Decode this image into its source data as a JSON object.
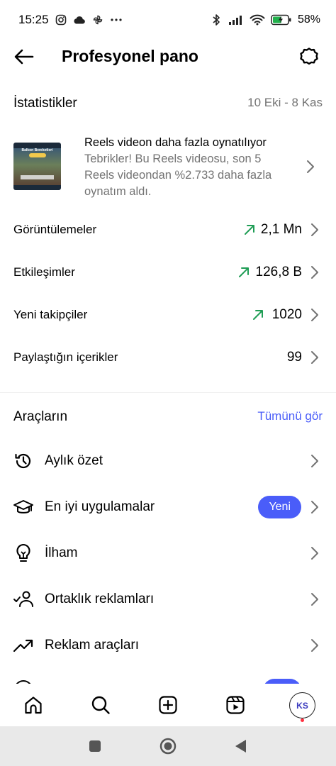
{
  "status_bar": {
    "time": "15:25",
    "battery": "58%"
  },
  "header": {
    "title": "Profesyonel pano"
  },
  "stats": {
    "title": "İstatistikler",
    "date_range": "10 Eki - 8 Kas",
    "insight": {
      "title": "Reels videon daha fazla oynatılıyor",
      "description": "Tebrikler! Bu Reels videosu, son 5 Reels videondan %2.733 daha fazla oynatım aldı.",
      "thumbnail_caption": "Balkon Bereketleri"
    },
    "rows": [
      {
        "label": "Görüntülemeler",
        "value": "2,1 Mn",
        "trend": "up"
      },
      {
        "label": "Etkileşimler",
        "value": "126,8 B",
        "trend": "up"
      },
      {
        "label": "Yeni takipçiler",
        "value": "1020",
        "trend": "up"
      },
      {
        "label": "Paylaştığın içerikler",
        "value": "99",
        "trend": "none"
      }
    ]
  },
  "tools": {
    "title": "Araçların",
    "see_all": "Tümünü gör",
    "items": [
      {
        "label": "Aylık özet",
        "icon": "history-icon"
      },
      {
        "label": "En iyi uygulamalar",
        "icon": "graduation-cap-icon",
        "badge": "Yeni"
      },
      {
        "label": "İlham",
        "icon": "lightbulb-icon"
      },
      {
        "label": "Ortaklık reklamları",
        "icon": "partner-check-icon"
      },
      {
        "label": "Reklam araçları",
        "icon": "trending-up-icon"
      }
    ]
  },
  "bottom_nav": {
    "items": [
      "home-icon",
      "search-icon",
      "create-icon",
      "reels-icon",
      "profile-avatar"
    ],
    "avatar_text": "KS"
  },
  "colors": {
    "accent": "#4a5df9",
    "trend_up": "#1f9d55",
    "muted": "#737373"
  }
}
